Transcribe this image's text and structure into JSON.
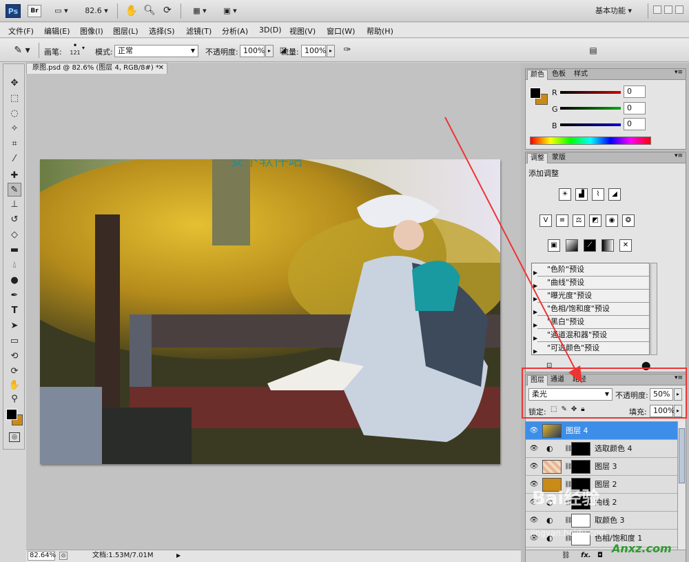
{
  "appbar": {
    "ps_label": "Ps",
    "br_label": "Br",
    "zoom": "82.6",
    "workspace": "基本功能"
  },
  "menu": [
    "文件(F)",
    "编辑(E)",
    "图像(I)",
    "图层(L)",
    "选择(S)",
    "滤镜(T)",
    "分析(A)",
    "3D(D)",
    "视图(V)",
    "窗口(W)",
    "帮助(H)"
  ],
  "options": {
    "brush_label": "画笔:",
    "brush_size": "121",
    "mode_label": "模式:",
    "mode_value": "正常",
    "opacity_label": "不透明度:",
    "opacity_value": "100%",
    "flow_label": "流量:",
    "flow_value": "100%"
  },
  "document": {
    "tab_title": "原图.psd @ 82.6% (图层 4, RGB/8#) *",
    "watermark": "安下软件站"
  },
  "status": {
    "zoom": "82.64%",
    "doc_info": "文档:1.53M/7.01M"
  },
  "color_panel": {
    "tabs": [
      "颜色",
      "色板",
      "样式"
    ],
    "channels": [
      {
        "label": "R",
        "value": "0",
        "color": "#cc0000"
      },
      {
        "label": "G",
        "value": "0",
        "color": "#00aa00"
      },
      {
        "label": "B",
        "value": "0",
        "color": "#0000cc"
      }
    ]
  },
  "adjust_panel": {
    "tabs": [
      "调整",
      "蒙版"
    ],
    "title": "添加调整",
    "presets": [
      "\"色阶\"预设",
      "\"曲线\"预设",
      "\"曝光度\"预设",
      "\"色相/饱和度\"预设",
      "\"黑白\"预设",
      "\"通道混和器\"预设",
      "\"可选颜色\"预设"
    ]
  },
  "layers_panel": {
    "tabs": [
      "图层",
      "通道",
      "路径"
    ],
    "blend_mode": "柔光",
    "opacity_label": "不透明度:",
    "opacity_value": "50%",
    "lock_label": "锁定:",
    "fill_label": "填充:",
    "fill_value": "100%",
    "layers": [
      {
        "name": "图层 4",
        "selected": true,
        "thumb": "photo",
        "mask": false
      },
      {
        "name": "选取颜色 4",
        "selected": false,
        "thumb": "adjust",
        "mask": true
      },
      {
        "name": "图层 3",
        "selected": false,
        "thumb": "checker",
        "mask": true
      },
      {
        "name": "图层 2",
        "selected": false,
        "thumb": "orange",
        "mask": true
      },
      {
        "name": "曲线 2",
        "selected": false,
        "thumb": "adjust",
        "mask": true
      },
      {
        "name": "取颜色 3",
        "selected": false,
        "thumb": "adjust",
        "mask": true
      },
      {
        "name": "色相/饱和度 1",
        "selected": false,
        "thumb": "adjust",
        "mask": true
      }
    ],
    "footer_icons": [
      "link-icon",
      "fx-icon",
      "mask-icon"
    ]
  },
  "watermarks": {
    "baidu": "Bai经验",
    "jingyan": "jingyan.baidu.com",
    "anxz": "Anxz.com"
  },
  "colors": {
    "accent_red": "#ee3333",
    "selected_layer": "#3d8ee8",
    "foreground": "#000000",
    "background": "#c98a17"
  }
}
